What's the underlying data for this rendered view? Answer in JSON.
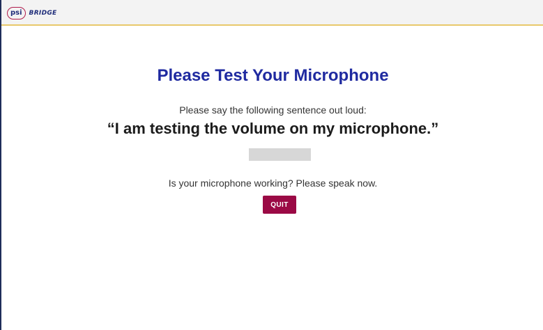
{
  "header": {
    "logo_badge": "psi",
    "logo_word": "BRIDGE"
  },
  "main": {
    "title": "Please Test Your Microphone",
    "instruction": "Please say the following sentence out loud:",
    "sentence": "“I am testing the volume on my microphone.”",
    "microphone_level": 0,
    "question": "Is your microphone working? Please speak now.",
    "quit_label": "QUIT"
  },
  "colors": {
    "title": "#1f2aa0",
    "quit_button": "#9b0a45",
    "meter_track": "#d7d7d7",
    "header_border": "#e8c86a"
  }
}
